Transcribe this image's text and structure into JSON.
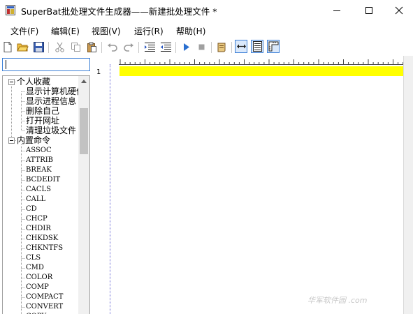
{
  "window": {
    "title": "SuperBat批处理文件生成器——新建批处理文件 *"
  },
  "menu": [
    {
      "label": "文件(F)"
    },
    {
      "label": "编辑(E)"
    },
    {
      "label": "视图(V)"
    },
    {
      "label": "运行(R)"
    },
    {
      "label": "帮助(H)"
    }
  ],
  "toolbar": {
    "icons": [
      "new-file-icon",
      "open-folder-icon",
      "save-icon",
      "cut-icon",
      "copy-icon",
      "paste-icon",
      "undo-icon",
      "redo-icon",
      "indent-icon",
      "outdent-icon",
      "run-icon",
      "stop-icon",
      "script-icon",
      "word-wrap-icon",
      "line-numbers-icon",
      "ruler-icon"
    ]
  },
  "search": {
    "value": ""
  },
  "tree": {
    "favorites": {
      "label": "个人收藏",
      "items": [
        "显示计算机硬件",
        "显示进程信息",
        "删除自己",
        "打开网址",
        "清理垃圾文件"
      ]
    },
    "builtin": {
      "label": "内置命令",
      "items": [
        "ASSOC",
        "ATTRIB",
        "BREAK",
        "BCDEDIT",
        "CACLS",
        "CALL",
        "CD",
        "CHCP",
        "CHDIR",
        "CHKDSK",
        "CHKNTFS",
        "CLS",
        "CMD",
        "COLOR",
        "COMP",
        "COMPACT",
        "CONVERT",
        "COPY"
      ]
    }
  },
  "editor": {
    "line_number": "1"
  },
  "watermark": "华军软件园 .com"
}
